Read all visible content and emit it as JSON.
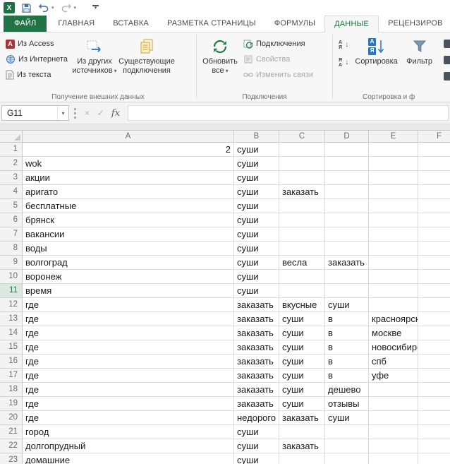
{
  "colors": {
    "excel_green": "#217346",
    "accent_blue": "#2e75b6",
    "disabled_gray": "#a8a8a8"
  },
  "glyphs": {
    "chevron_down": "▾",
    "down_arrow": "↓"
  },
  "title_bar": {
    "logo_glyph": "X"
  },
  "ribbon_tabs": [
    {
      "id": "file",
      "label": "ФАЙЛ",
      "file": true
    },
    {
      "id": "home",
      "label": "ГЛАВНАЯ"
    },
    {
      "id": "insert",
      "label": "ВСТАВКА"
    },
    {
      "id": "page-layout",
      "label": "РАЗМЕТКА СТРАНИЦЫ"
    },
    {
      "id": "formulas",
      "label": "ФОРМУЛЫ"
    },
    {
      "id": "data",
      "label": "ДАННЫЕ",
      "active": true
    },
    {
      "id": "review",
      "label": "РЕЦЕНЗИРОВ"
    }
  ],
  "ribbon": {
    "external": {
      "small_buttons": [
        {
          "id": "from-access",
          "label": "Из Access",
          "icon_glyph": "A"
        },
        {
          "id": "from-web",
          "label": "Из Интернета"
        },
        {
          "id": "from-text",
          "label": "Из текста"
        }
      ],
      "big_buttons": [
        {
          "id": "from-other-sources",
          "label": "Из других источников",
          "dropdown": true
        },
        {
          "id": "existing-connections",
          "label": "Существующие подключения"
        }
      ],
      "group_label": "Получение внешних данных"
    },
    "connections": {
      "refresh_all_label": "Обновить все",
      "small_buttons": [
        {
          "id": "connections",
          "label": "Подключения",
          "disabled": false
        },
        {
          "id": "properties",
          "label": "Свойства",
          "disabled": true
        },
        {
          "id": "edit-links",
          "label": "Изменить связи",
          "disabled": true
        }
      ],
      "group_label": "Подключения"
    },
    "sort_filter": {
      "asc_top": "А",
      "asc_bottom": "Я",
      "desc_top": "Я",
      "desc_bottom": "А",
      "icon_top": "А",
      "icon_bottom": "Я",
      "sort_label": "Сортировка",
      "filter_label": "Фильтр",
      "group_label": "Сортировка и ф"
    }
  },
  "formula_bar": {
    "name_box": "G11",
    "cancel_glyph": "×",
    "enter_glyph": "✓",
    "fx_label": "fx",
    "formula_value": ""
  },
  "grid": {
    "columns": [
      "A",
      "B",
      "C",
      "D",
      "E",
      "F"
    ],
    "selected_row": 11,
    "rows": [
      {
        "n": 1,
        "cells": [
          "2",
          "суши",
          "",
          "",
          "",
          ""
        ]
      },
      {
        "n": 2,
        "cells": [
          "wok",
          "суши",
          "",
          "",
          "",
          ""
        ]
      },
      {
        "n": 3,
        "cells": [
          "акции",
          "суши",
          "",
          "",
          "",
          ""
        ]
      },
      {
        "n": 4,
        "cells": [
          "аригато",
          "суши",
          "заказать",
          "",
          "",
          ""
        ]
      },
      {
        "n": 5,
        "cells": [
          "бесплатные",
          "суши",
          "",
          "",
          "",
          ""
        ]
      },
      {
        "n": 6,
        "cells": [
          "брянск",
          "суши",
          "",
          "",
          "",
          ""
        ]
      },
      {
        "n": 7,
        "cells": [
          "вакансии",
          "суши",
          "",
          "",
          "",
          ""
        ]
      },
      {
        "n": 8,
        "cells": [
          "воды",
          "суши",
          "",
          "",
          "",
          ""
        ]
      },
      {
        "n": 9,
        "cells": [
          "волгоград",
          "суши",
          "весла",
          "заказать",
          "",
          ""
        ]
      },
      {
        "n": 10,
        "cells": [
          "воронеж",
          "суши",
          "",
          "",
          "",
          ""
        ]
      },
      {
        "n": 11,
        "cells": [
          "время",
          "суши",
          "",
          "",
          "",
          ""
        ]
      },
      {
        "n": 12,
        "cells": [
          "где",
          "заказать",
          "вкусные",
          "суши",
          "",
          ""
        ]
      },
      {
        "n": 13,
        "cells": [
          "где",
          "заказать",
          "суши",
          "в",
          "красноярске",
          ""
        ]
      },
      {
        "n": 14,
        "cells": [
          "где",
          "заказать",
          "суши",
          "в",
          "москве",
          ""
        ]
      },
      {
        "n": 15,
        "cells": [
          "где",
          "заказать",
          "суши",
          "в",
          "новосибирске",
          ""
        ]
      },
      {
        "n": 16,
        "cells": [
          "где",
          "заказать",
          "суши",
          "в",
          "спб",
          ""
        ]
      },
      {
        "n": 17,
        "cells": [
          "где",
          "заказать",
          "суши",
          "в",
          "уфе",
          ""
        ]
      },
      {
        "n": 18,
        "cells": [
          "где",
          "заказать",
          "суши",
          "дешево",
          "",
          ""
        ]
      },
      {
        "n": 19,
        "cells": [
          "где",
          "заказать",
          "суши",
          "отзывы",
          "",
          ""
        ]
      },
      {
        "n": 20,
        "cells": [
          "где",
          "недорого",
          "заказать",
          "суши",
          "",
          ""
        ]
      },
      {
        "n": 21,
        "cells": [
          "город",
          "суши",
          "",
          "",
          "",
          ""
        ]
      },
      {
        "n": 22,
        "cells": [
          "долгопрудный",
          "суши",
          "заказать",
          "",
          "",
          ""
        ]
      },
      {
        "n": 23,
        "cells": [
          "домашние",
          "суши",
          "",
          "",
          "",
          ""
        ]
      }
    ]
  }
}
